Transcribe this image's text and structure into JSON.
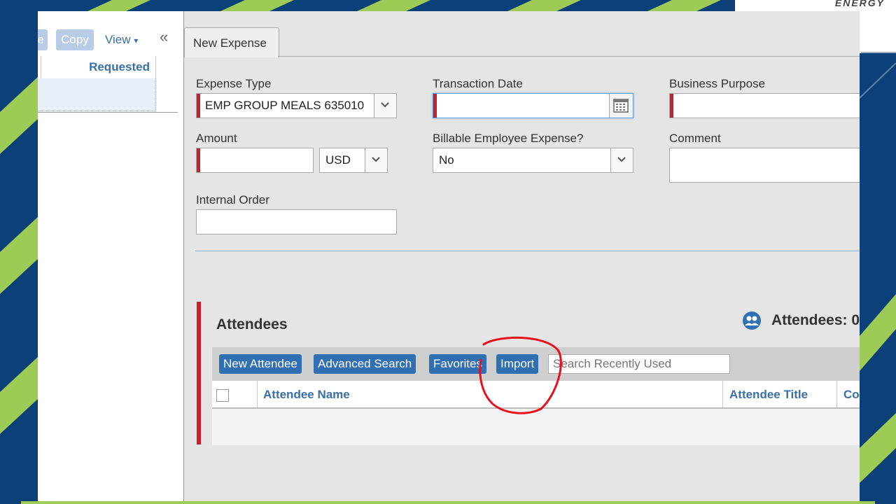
{
  "brand": {
    "text": "ENERGY"
  },
  "left_pane": {
    "toolbar": {
      "partial_label": "e",
      "copy_label": "Copy",
      "view_label": "View",
      "view_caret": "▾",
      "collapse_glyph": "«"
    },
    "column_header": "Requested"
  },
  "tab": {
    "label": "New Expense"
  },
  "form": {
    "expense_type": {
      "label": "Expense Type",
      "value": "EMP GROUP MEALS 635010"
    },
    "transaction_date": {
      "label": "Transaction Date",
      "value": ""
    },
    "business_purpose": {
      "label": "Business Purpose",
      "value": ""
    },
    "amount": {
      "label": "Amount",
      "value": ""
    },
    "currency": {
      "value": "USD"
    },
    "billable": {
      "label": "Billable Employee Expense?",
      "value": "No"
    },
    "comment": {
      "label": "Comment",
      "value": ""
    },
    "internal_order": {
      "label": "Internal Order",
      "value": ""
    }
  },
  "attendees": {
    "title": "Attendees",
    "count_label": "Attendees: 0",
    "buttons": {
      "new_attendee": "New Attendee",
      "advanced_search": "Advanced Search",
      "favorites": "Favorites",
      "import": "Import"
    },
    "search_placeholder": "Search Recently Used",
    "columns": {
      "name": "Attendee Name",
      "title": "Attendee Title",
      "company": "Co"
    }
  },
  "colors": {
    "accent_blue": "#2f6fb2",
    "required_red": "#c8202f",
    "annotation_red": "#e8101c",
    "bg_navy": "#0d3f78",
    "bg_green": "#9ccb56"
  }
}
